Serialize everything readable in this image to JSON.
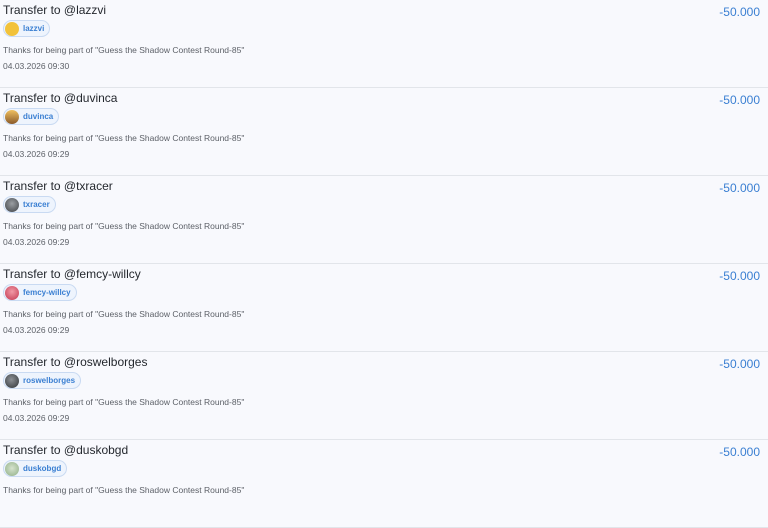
{
  "transfers": [
    {
      "title": "Transfer to @lazzvi",
      "user": "lazzvi",
      "memo": "Thanks for being part of \"Guess the Shadow Contest Round-85\"",
      "date": "04.03.2026 09:30",
      "amount": "-50.000",
      "avatar_color": "#f2c23a"
    },
    {
      "title": "Transfer to @duvinca",
      "user": "duvinca",
      "memo": "Thanks for being part of \"Guess the Shadow Contest Round-85\"",
      "date": "04.03.2026 09:29",
      "amount": "-50.000",
      "avatar_color": "#c98a3a"
    },
    {
      "title": "Transfer to @txracer",
      "user": "txracer",
      "memo": "Thanks for being part of \"Guess the Shadow Contest Round-85\"",
      "date": "04.03.2026 09:29",
      "amount": "-50.000",
      "avatar_color": "#6a6e73"
    },
    {
      "title": "Transfer to @femcy-willcy",
      "user": "femcy-willcy",
      "memo": "Thanks for being part of \"Guess the Shadow Contest Round-85\"",
      "date": "04.03.2026 09:29",
      "amount": "-50.000",
      "avatar_color": "#d9536a"
    },
    {
      "title": "Transfer to @roswelborges",
      "user": "roswelborges",
      "memo": "Thanks for being part of \"Guess the Shadow Contest Round-85\"",
      "date": "04.03.2026 09:29",
      "amount": "-50.000",
      "avatar_color": "#55595e"
    },
    {
      "title": "Transfer to @duskobgd",
      "user": "duskobgd",
      "memo": "Thanks for being part of \"Guess the Shadow Contest Round-85\"",
      "date": "",
      "amount": "-50.000",
      "avatar_color": "#a9c3a0"
    }
  ]
}
